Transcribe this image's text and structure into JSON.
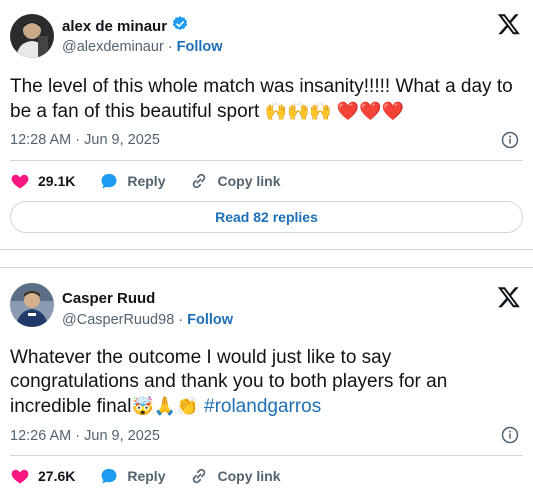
{
  "tweets": [
    {
      "author": "alex de minaur",
      "verified": true,
      "handle": "@alexdeminaur",
      "separator": "·",
      "follow_label": "Follow",
      "text": "The level of this whole match was insanity!!!!! What a day to be a fan of this beautiful sport",
      "emojis": "🙌🙌🙌 ❤️❤️❤️",
      "timestamp": "12:28 AM · Jun 9, 2025",
      "likes": "29.1K",
      "reply_label": "Reply",
      "copy_link_label": "Copy link",
      "read_replies_label": "Read 82 replies",
      "colors": {
        "like": "#f91880",
        "reply": "#1d9bf0",
        "follow": "#1d6fb8"
      }
    },
    {
      "author": "Casper Ruud",
      "verified": false,
      "handle": "@CasperRuud98",
      "separator": "·",
      "follow_label": "Follow",
      "text_before": "Whatever the outcome I would just like to say congratulations and thank you to both players for an incredible final",
      "emojis": "🤯🙏👏",
      "hashtag": "#rolandgarros",
      "timestamp": "12:26 AM · Jun 9, 2025",
      "likes": "27.6K",
      "reply_label": "Reply",
      "copy_link_label": "Copy link"
    }
  ]
}
